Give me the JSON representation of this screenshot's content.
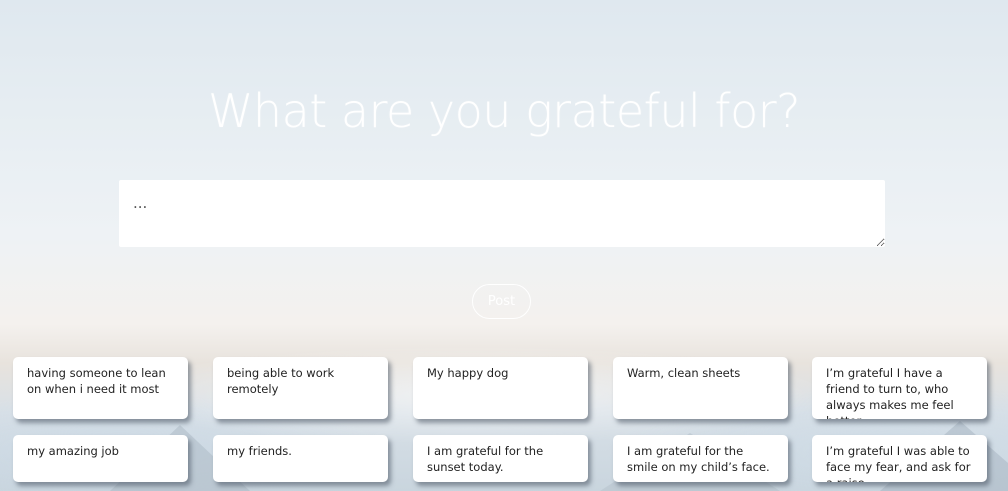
{
  "header": {
    "title": "What are you grateful for?"
  },
  "composer": {
    "placeholder": "...",
    "value": "",
    "post_label": "Post"
  },
  "posts": [
    "having someone to lean on when i need it most",
    "being able to work remotely",
    "My happy dog",
    "Warm, clean sheets",
    "I’m grateful I have a friend to turn to, who always makes me feel better.",
    "my amazing job",
    "my friends.",
    "I am grateful for the sunset today.",
    "I am grateful for the smile on my child’s face.",
    "I’m grateful I was able to face my fear, and ask for a raise."
  ]
}
